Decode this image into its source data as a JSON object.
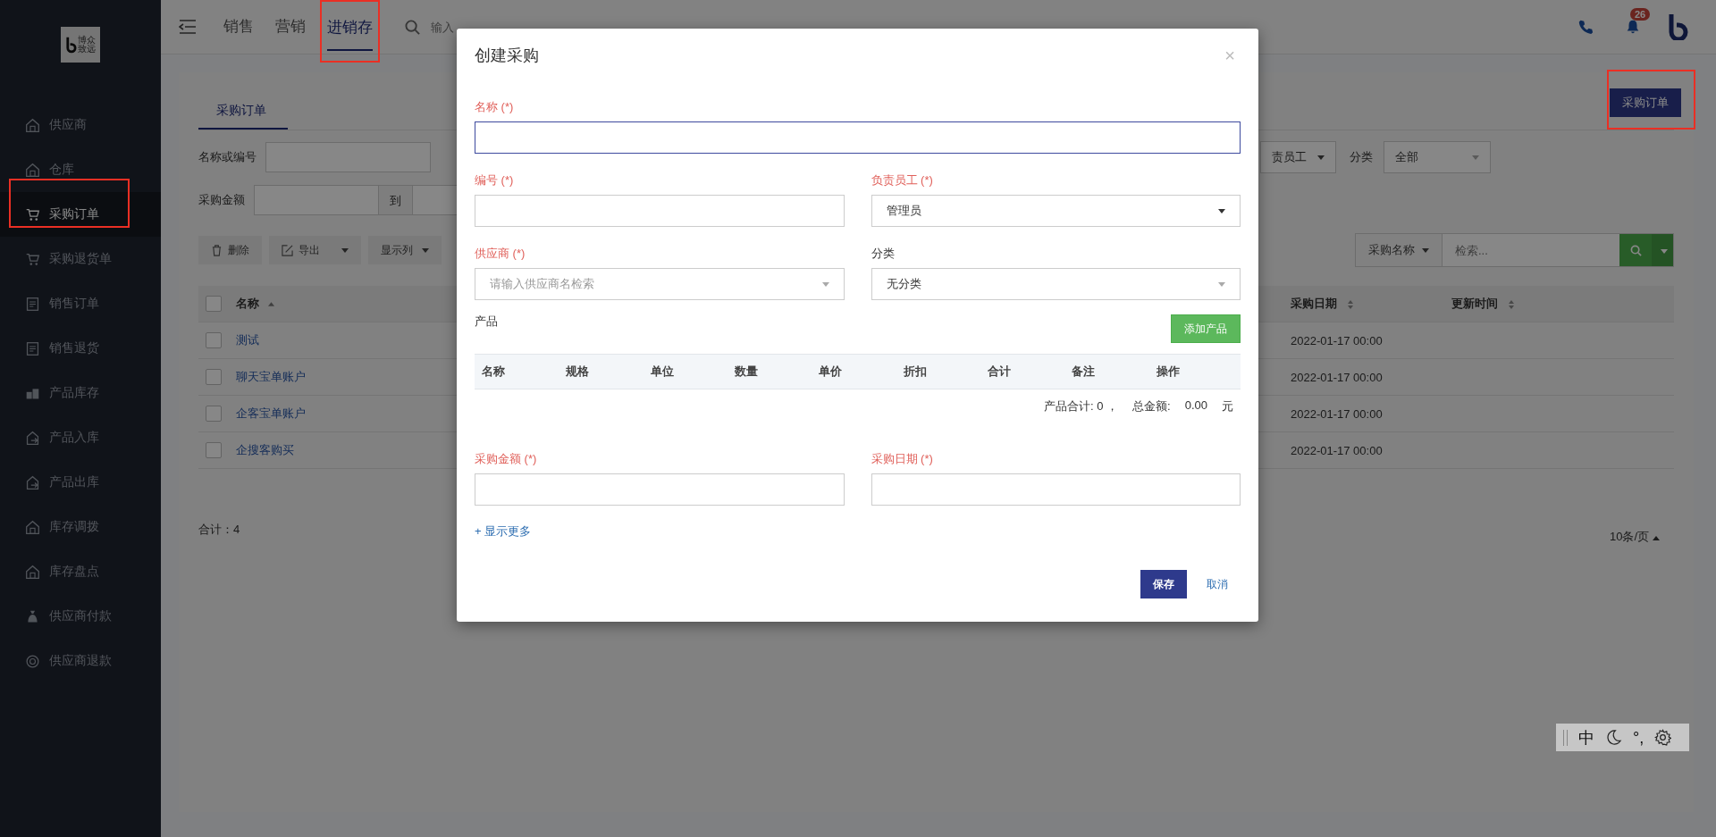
{
  "sidebar": {
    "logo_text": "博众致远",
    "items": [
      {
        "label": "供应商",
        "selected": false
      },
      {
        "label": "仓库",
        "selected": false
      },
      {
        "label": "采购订单",
        "selected": true
      },
      {
        "label": "采购退货单",
        "selected": false
      },
      {
        "label": "销售订单",
        "selected": false
      },
      {
        "label": "销售退货",
        "selected": false
      },
      {
        "label": "产品库存",
        "selected": false
      },
      {
        "label": "产品入库",
        "selected": false
      },
      {
        "label": "产品出库",
        "selected": false
      },
      {
        "label": "库存调拨",
        "selected": false
      },
      {
        "label": "库存盘点",
        "selected": false
      },
      {
        "label": "供应商付款",
        "selected": false
      },
      {
        "label": "供应商退款",
        "selected": false
      }
    ]
  },
  "topbar": {
    "nav": [
      {
        "label": "销售",
        "selected": false
      },
      {
        "label": "营销",
        "selected": false
      },
      {
        "label": "进销存",
        "selected": true
      }
    ],
    "search": {
      "placeholder": "输入"
    },
    "notification_count": "26"
  },
  "page": {
    "tabs": [
      {
        "label": "采购订单",
        "selected": true
      }
    ],
    "create_button": "采购订单",
    "filters": {
      "name_label": "名称或编号",
      "staff_select": "责员工",
      "category_label": "分类",
      "category_value": "全部",
      "amount_label": "采购金额",
      "amount_to": "到"
    },
    "toolbar": {
      "delete": "删除",
      "export": "导出",
      "columns": "显示列"
    },
    "search": {
      "field": "采购名称",
      "placeholder": "检索..."
    },
    "table": {
      "all_checked": false,
      "columns": [
        "名称",
        "采购日期",
        "更新时间"
      ],
      "rows": [
        {
          "name": "测试",
          "date": "2022-01-17 00:00",
          "checked": false
        },
        {
          "name": "聊天宝单账户",
          "date": "2022-01-17 00:00",
          "checked": false
        },
        {
          "name": "企客宝单账户",
          "date": "2022-01-17 00:00",
          "checked": false
        },
        {
          "name": "企搜客购买",
          "date": "2022-01-17 00:00",
          "checked": false
        }
      ]
    },
    "total": "合计：4",
    "page_size": "10条/页"
  },
  "modal": {
    "title": "创建采购",
    "close": "×",
    "rows": [
      [
        {
          "label": "名称 (*)",
          "required": true,
          "kind": "input",
          "focused": true
        }
      ],
      [
        {
          "label": "编号 (*)",
          "required": true,
          "kind": "input",
          "focused": false
        },
        {
          "label": "负责员工 (*)",
          "required": true,
          "kind": "select",
          "value": "管理员"
        }
      ],
      [
        {
          "label": "供应商 (*)",
          "required": true,
          "kind": "select",
          "placeholder": "请输入供应商名检索"
        },
        {
          "label": "分类",
          "required": false,
          "kind": "select",
          "value": "无分类"
        }
      ]
    ],
    "products": {
      "label": "产品",
      "add_button": "添加产品",
      "columns": [
        "名称",
        "规格",
        "单位",
        "数量",
        "单价",
        "折扣",
        "合计",
        "备注",
        "操作"
      ],
      "summary": [
        "产品合计: 0 ，",
        "总金额:",
        "0.00",
        "元"
      ]
    },
    "rows_after": [
      [
        {
          "label": "采购金额 (*)",
          "required": true,
          "kind": "input",
          "focused": false
        },
        {
          "label": "采购日期 (*)",
          "required": true,
          "kind": "input",
          "focused": false
        }
      ]
    ],
    "show_more": "+ 显示更多",
    "save": "保存",
    "cancel": "取消"
  },
  "ime_toolbar": {
    "mode": "中",
    "punctuation": "°,"
  }
}
